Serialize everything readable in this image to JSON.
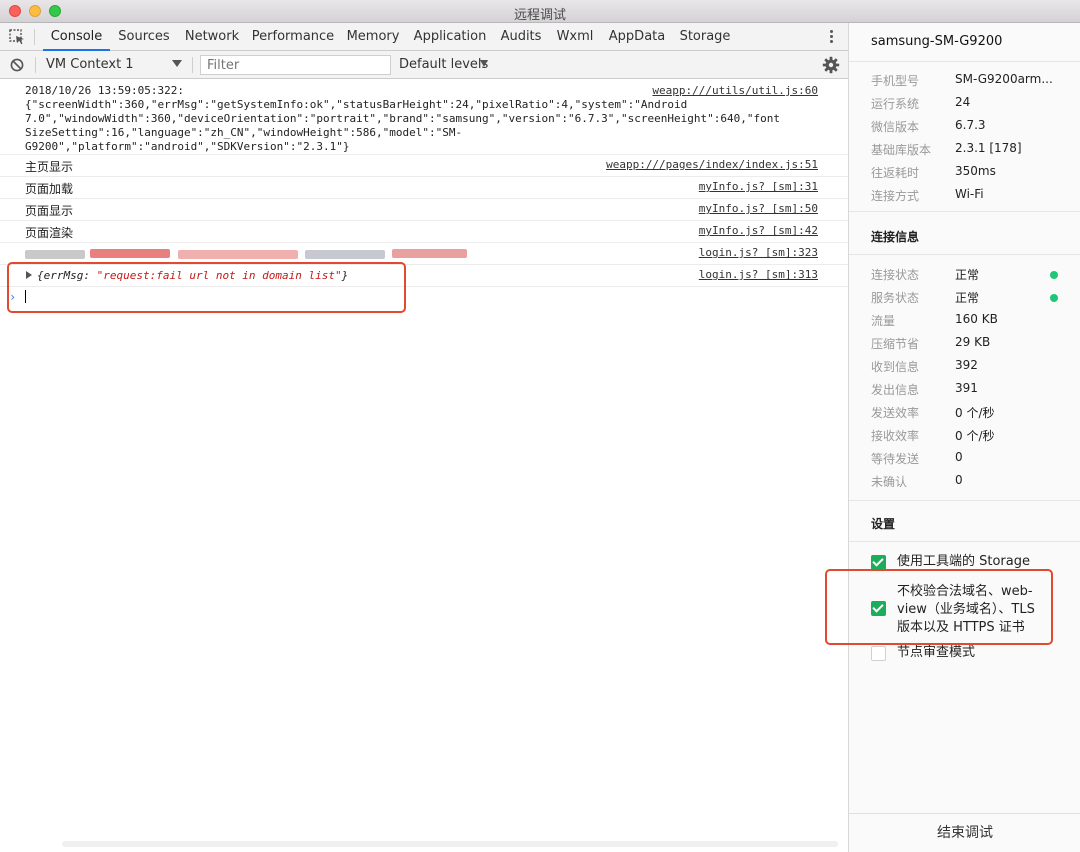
{
  "window": {
    "title": "远程调试"
  },
  "tabs": [
    "Console",
    "Sources",
    "Network",
    "Performance",
    "Memory",
    "Application",
    "Audits",
    "Wxml",
    "AppData",
    "Storage"
  ],
  "toolbar": {
    "context": "VM Context 1",
    "filter_placeholder": "Filter",
    "levels": "Default levels"
  },
  "console": {
    "log1_lines": [
      "2018/10/26 13:59:05:322:",
      "{\"screenWidth\":360,\"errMsg\":\"getSystemInfo:ok\",\"statusBarHeight\":24,\"pixelRatio\":4,\"system\":\"Android",
      "7.0\",\"windowWidth\":360,\"deviceOrientation\":\"portrait\",\"brand\":\"samsung\",\"version\":\"6.7.3\",\"screenHeight\":640,\"font",
      "SizeSetting\":16,\"language\":\"zh_CN\",\"windowHeight\":586,\"model\":\"SM-",
      "G9200\",\"platform\":\"android\",\"SDKVersion\":\"2.3.1\"}"
    ],
    "log1_src": "weapp:///utils/util.js:60",
    "log2_text": "主页显示",
    "log2_src": "weapp:///pages/index/index.js:51",
    "log3_text": "页面加载",
    "log3_src": "myInfo.js? [sm]:31",
    "log4_text": "页面显示",
    "log4_src": "myInfo.js? [sm]:50",
    "log5_text": "页面渲染",
    "log5_src": "myInfo.js? [sm]:42",
    "log6_src": "login.js? [sm]:323",
    "log7_key": "{errMsg: ",
    "log7_str": "\"request:fail url not in domain list\"",
    "log7_end": "}",
    "log7_src": "login.js? [sm]:313",
    "prompt": "›"
  },
  "panel": {
    "device": "samsung-SM-G9200",
    "device_info": [
      {
        "label": "手机型号",
        "value": "SM-G9200arm..."
      },
      {
        "label": "运行系统",
        "value": "24"
      },
      {
        "label": "微信版本",
        "value": "6.7.3"
      },
      {
        "label": "基础库版本",
        "value": "2.3.1 [178]"
      },
      {
        "label": "往返耗时",
        "value": "350ms"
      },
      {
        "label": "连接方式",
        "value": "Wi-Fi"
      }
    ],
    "conn_title": "连接信息",
    "conn_info": [
      {
        "label": "连接状态",
        "value": "正常"
      },
      {
        "label": "服务状态",
        "value": "正常"
      },
      {
        "label": "流量",
        "value": "160 KB"
      },
      {
        "label": "压缩节省",
        "value": "29 KB"
      },
      {
        "label": "收到信息",
        "value": "392"
      },
      {
        "label": "发出信息",
        "value": "391"
      },
      {
        "label": "发送效率",
        "value": "0 个/秒"
      },
      {
        "label": "接收效率",
        "value": "0 个/秒"
      },
      {
        "label": "等待发送",
        "value": "0"
      },
      {
        "label": "未确认",
        "value": "0"
      }
    ],
    "settings_title": "设置",
    "setting1": "使用工具端的 Storage",
    "setting2_lines": [
      "不校验合法域名、web-",
      "view（业务域名）、TLS",
      "版本以及 HTTPS 证书"
    ],
    "setting3": "节点审查模式",
    "end_button": "结束调试"
  },
  "colors": {
    "accent": "#1a73e8",
    "highlight": "#e2492f",
    "ok": "#1fc677",
    "check": "#1aad5a"
  }
}
